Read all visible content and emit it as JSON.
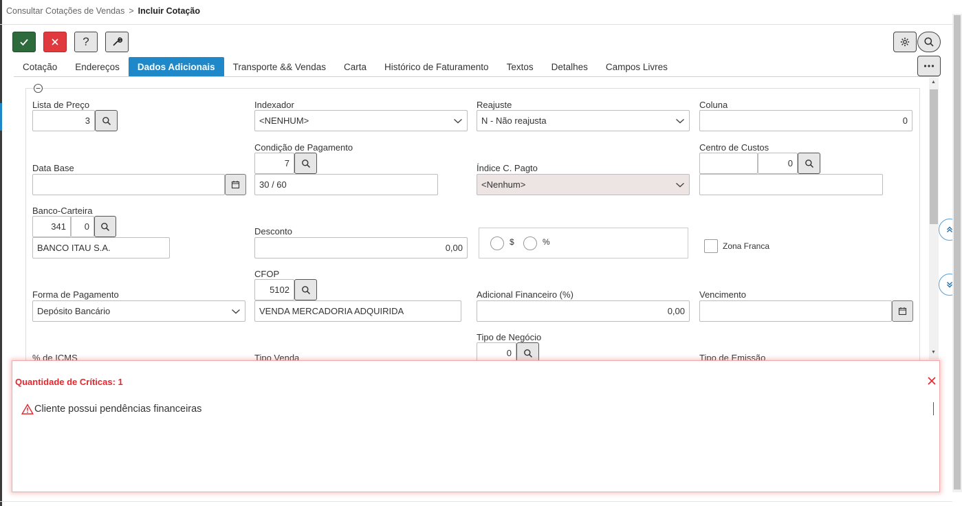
{
  "breadcrumb": {
    "parent": "Consultar Cotações de Vendas",
    "separator": ">",
    "current": "Incluir Cotação"
  },
  "toolbar": {
    "help_label": "?"
  },
  "tabs": [
    {
      "label": "Cotação"
    },
    {
      "label": "Endereços"
    },
    {
      "label": "Dados Adicionais",
      "active": true
    },
    {
      "label": "Transporte && Vendas"
    },
    {
      "label": "Carta"
    },
    {
      "label": "Histórico de Faturamento"
    },
    {
      "label": "Textos"
    },
    {
      "label": "Detalhes"
    },
    {
      "label": "Campos Livres"
    }
  ],
  "form": {
    "lista_preco": {
      "label": "Lista de Preço",
      "value": "3"
    },
    "indexador": {
      "label": "Indexador",
      "value": "<NENHUM>"
    },
    "reajuste": {
      "label": "Reajuste",
      "value": "N - Não reajusta"
    },
    "coluna": {
      "label": "Coluna",
      "value": "0"
    },
    "condicao_pagamento": {
      "label": "Condição de Pagamento",
      "code": "7",
      "description": "30 / 60"
    },
    "data_base": {
      "label": "Data Base",
      "value": ""
    },
    "indice_c_pagto": {
      "label": "Índice C. Pagto",
      "value": "<Nenhum>"
    },
    "centro_custos": {
      "label": "Centro de Custos",
      "code1": "",
      "code2": "0",
      "description": ""
    },
    "banco_carteira": {
      "label": "Banco-Carteira",
      "banco": "341",
      "carteira": "0",
      "description": "BANCO ITAU S.A."
    },
    "desconto": {
      "label": "Desconto",
      "value": "0,00"
    },
    "desconto_tipo": {
      "option_currency": "$",
      "option_percent": "%"
    },
    "zona_franca": {
      "label": "Zona Franca",
      "checked": false
    },
    "cfop": {
      "label": "CFOP",
      "code": "5102",
      "description": "VENDA MERCADORIA ADQUIRIDA"
    },
    "forma_pagamento": {
      "label": "Forma de Pagamento",
      "value": "Depósito Bancário"
    },
    "adicional_financeiro": {
      "label": "Adicional Financeiro (%)",
      "value": "0,00"
    },
    "vencimento": {
      "label": "Vencimento",
      "value": ""
    },
    "tipo_negocio": {
      "label": "Tipo de Negócio",
      "value": "0"
    },
    "perc_icms": {
      "label": "% de ICMS"
    },
    "tipo_venda": {
      "label": "Tipo Venda"
    },
    "tipo_emissao": {
      "label": "Tipo de Emissão"
    }
  },
  "criticas": {
    "title": "Quantidade de Críticas: 1",
    "messages": [
      {
        "text": "Cliente possui pendências financeiras"
      }
    ]
  },
  "colors": {
    "accent": "#1e88c8",
    "ok": "#2e6b3c",
    "cancel": "#e03a3e",
    "critical": "#e8252a"
  }
}
